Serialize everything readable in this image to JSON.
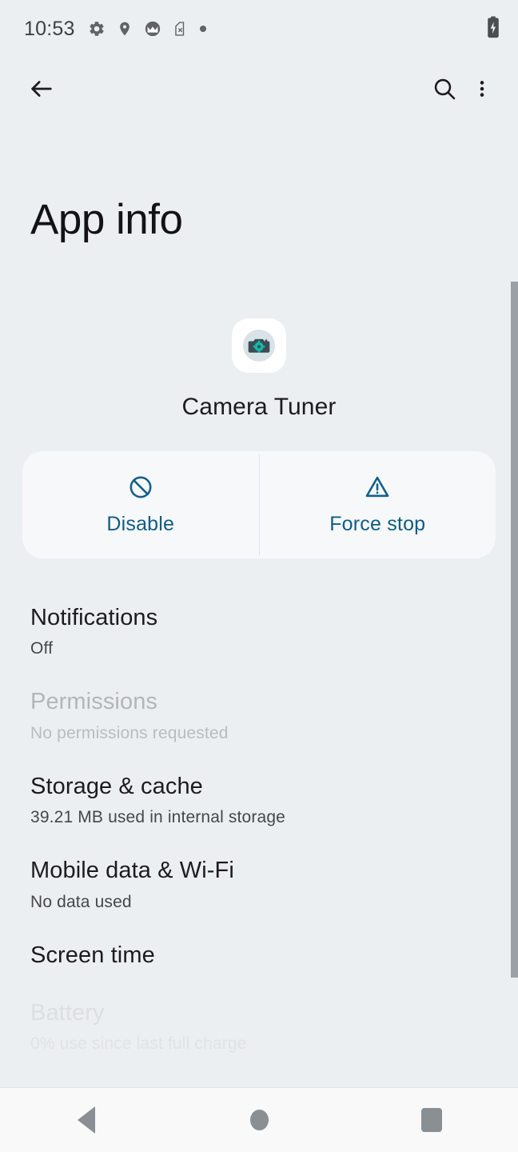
{
  "status_bar": {
    "clock": "10:53",
    "left_icons": [
      {
        "name": "settings-gear-icon",
        "label": "gear-icon"
      },
      {
        "name": "location-pin-icon",
        "label": "location-icon"
      },
      {
        "name": "motorola-logo-icon",
        "label": "motorola-icon"
      },
      {
        "name": "no-sim-card-icon",
        "label": "sim-card-x-icon"
      },
      {
        "name": "notification-dot-icon",
        "label": "dot-icon"
      }
    ],
    "right_icons": [
      {
        "name": "battery-charging-icon",
        "label": "battery-charging-icon"
      }
    ]
  },
  "toolbar": {
    "back_icon": "back-arrow-icon",
    "search_icon": "search-icon",
    "overflow_icon": "overflow-menu-icon"
  },
  "header": {
    "title": "App info"
  },
  "app": {
    "icon_name": "camera-tuner-app-icon",
    "name": "Camera Tuner"
  },
  "actions": {
    "accent_color": "#0f5c84",
    "buttons": [
      {
        "label": "Disable",
        "icon": "block-circle-slash-icon",
        "name": "disable-button"
      },
      {
        "label": "Force stop",
        "icon": "warning-triangle-icon",
        "name": "force-stop-button"
      }
    ]
  },
  "settings": {
    "items": [
      {
        "title": "Notifications",
        "subtitle": "Off",
        "state": "enabled",
        "name": "list-item-notifications"
      },
      {
        "title": "Permissions",
        "subtitle": "No permissions requested",
        "state": "disabled",
        "name": "list-item-permissions"
      },
      {
        "title": "Storage & cache",
        "subtitle": "39.21 MB used in internal storage",
        "state": "enabled",
        "name": "list-item-storage-cache"
      },
      {
        "title": "Mobile data & Wi-Fi",
        "subtitle": "No data used",
        "state": "enabled",
        "name": "list-item-mobile-data-wifi"
      },
      {
        "title": "Screen time",
        "subtitle": "",
        "state": "enabled",
        "name": "list-item-screen-time"
      },
      {
        "title": "Battery",
        "subtitle": "0% use since last full charge",
        "state": "faded",
        "name": "list-item-battery"
      }
    ]
  },
  "nav_bar": {
    "back": "nav-back-icon",
    "home": "nav-home-icon",
    "recents": "nav-recents-icon"
  }
}
